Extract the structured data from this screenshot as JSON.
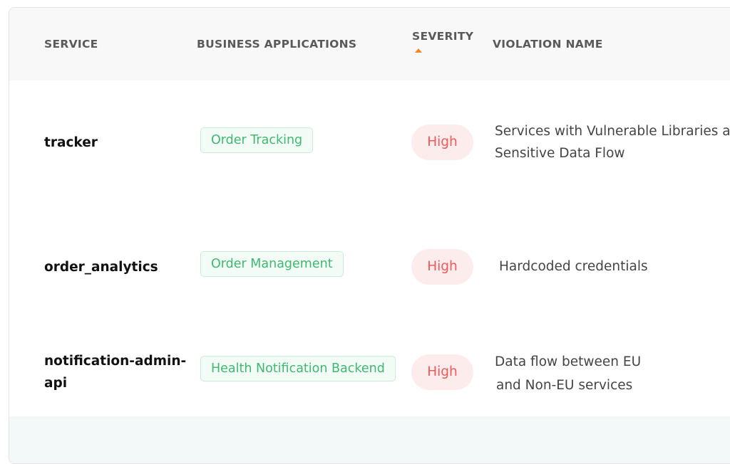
{
  "table": {
    "columns": {
      "service": "SERVICE",
      "business_applications": "BUSINESS APPLICATIONS",
      "severity": "SEVERITY",
      "violation_name": "VIOLATION NAME"
    },
    "sort": {
      "column": "severity",
      "direction": "ascending"
    },
    "rows": [
      {
        "service": "tracker",
        "business_application": "Order Tracking",
        "severity": "High",
        "violation_line1": "Services with Vulnerable Libraries a",
        "violation_line2": "Sensitive Data Flow"
      },
      {
        "service": "order_analytics",
        "business_application": "Order Management",
        "severity": "High",
        "violation_line1": "Hardcoded credentials"
      },
      {
        "service_line1": "notification-admin-",
        "service_line2": "api",
        "business_application": "Health Notification Backend",
        "severity": "High",
        "violation_line1": "Data flow between EU",
        "violation_line2": "and Non-EU services"
      }
    ]
  },
  "colors": {
    "app_tag_text": "#3fb872",
    "app_tag_bg": "#f3fbf6",
    "severity_high_text": "#ee5a5a",
    "severity_high_bg": "#fdecec",
    "sort_arrow": "#f08a24"
  }
}
